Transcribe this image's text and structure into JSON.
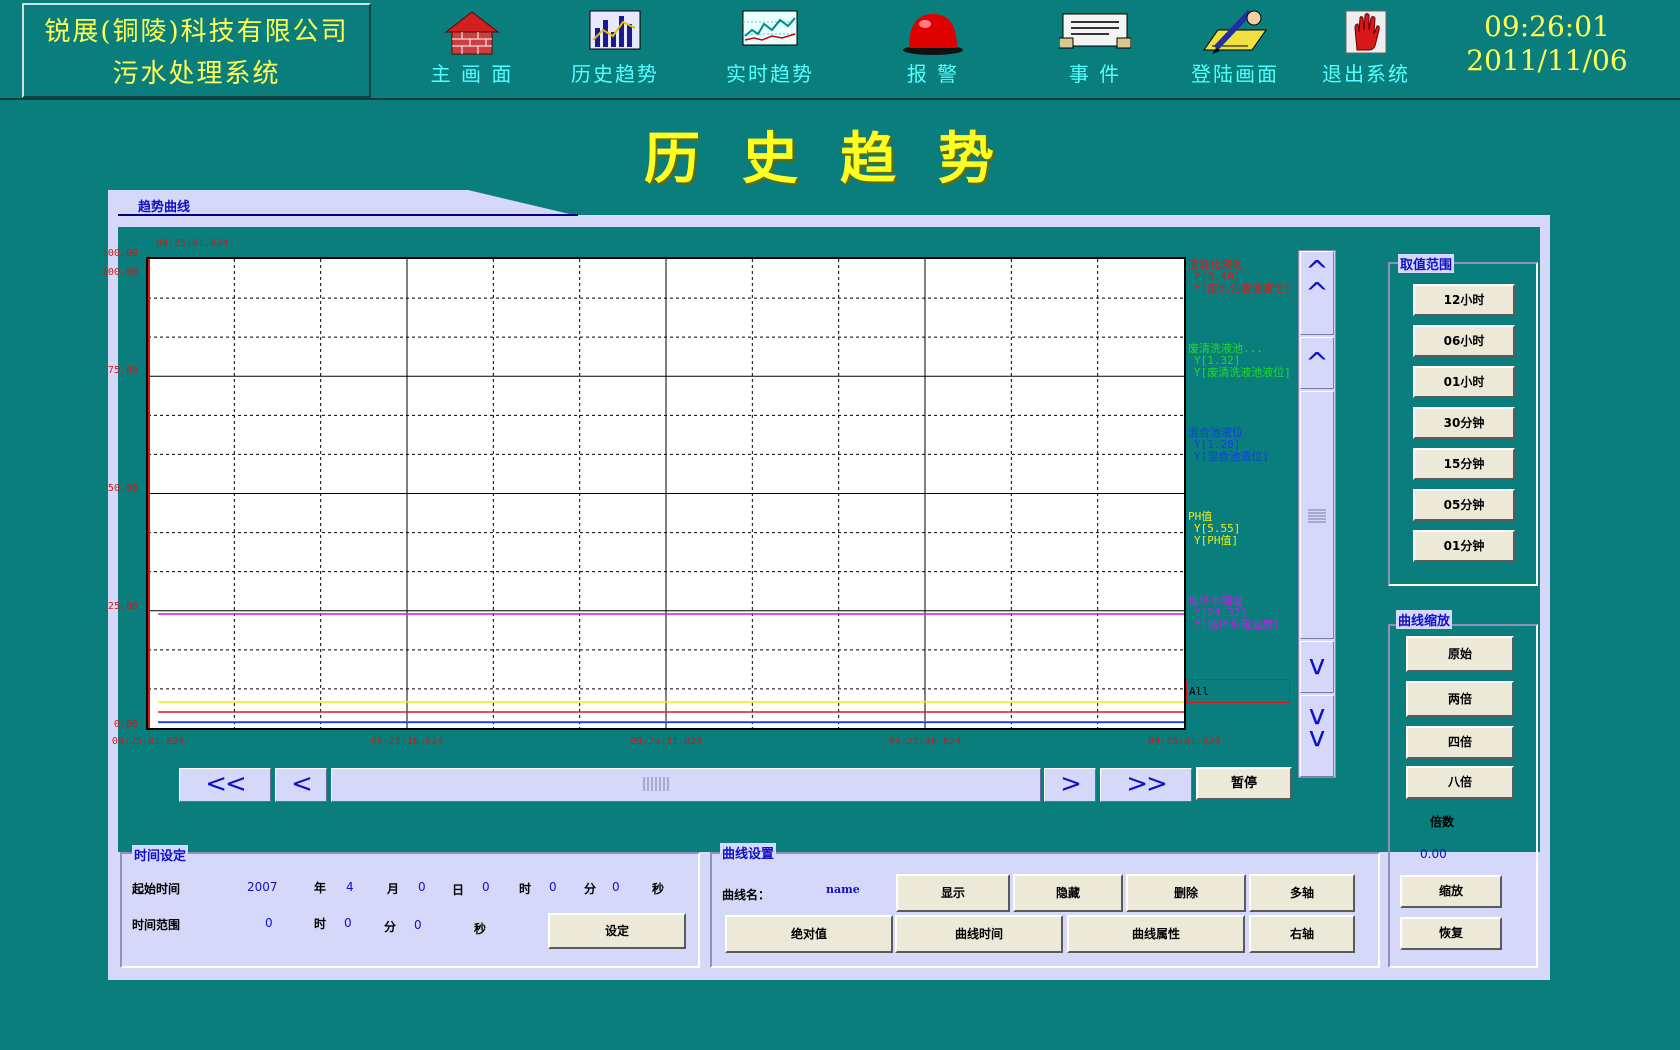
{
  "company": {
    "line1": "锐展(铜陵)科技有限公司",
    "line2": "污水处理系统"
  },
  "nav": [
    {
      "label": "主 画 面",
      "icon": "house-icon"
    },
    {
      "label": "历史趋势",
      "icon": "bar-chart-icon"
    },
    {
      "label": "实时趋势",
      "icon": "line-chart-icon"
    },
    {
      "label": "报    警",
      "icon": "alarm-light-icon"
    },
    {
      "label": "事   件",
      "icon": "printer-icon"
    },
    {
      "label": "登陆画面",
      "icon": "login-pen-icon"
    },
    {
      "label": "退出系统",
      "icon": "stop-hand-icon"
    }
  ],
  "clock": {
    "time": "09:26:01",
    "date": "2011/11/06"
  },
  "page_title": "历史趋势",
  "trend": {
    "tab_label": "趋势曲线",
    "cursor_time": "09:25:01.824",
    "all_label": "All",
    "pause_button": "暂停"
  },
  "chart_data": {
    "type": "line",
    "ylim": [
      0,
      100
    ],
    "y_ticks": [
      "0.00",
      "25.00",
      "50.00",
      "75.00",
      "100.00"
    ],
    "x_ticks": [
      "09:25:01.824",
      "09:25:16.824",
      "09:25:31.824",
      "09:25:46.824",
      "09:26:01.824"
    ],
    "grid": true,
    "series": [
      {
        "name": "废乳化液池",
        "value_label": "Y[3.40]",
        "tag_label": "Y[废乳化液池液位]",
        "color": "#e01818",
        "value": 3.4
      },
      {
        "name": "废清洗液池...",
        "value_label": "Y[1.32]",
        "tag_label": "Y[废清洗液池液位]",
        "color": "#22dd22",
        "value": 1.32
      },
      {
        "name": "混合池液位",
        "value_label": "Y[1.20]",
        "tag_label": "Y[混合池液位]",
        "color": "#1040e8",
        "value": 1.2
      },
      {
        "name": "PH值",
        "value_label": "Y[5.55]",
        "tag_label": "Y[PH值]",
        "color": "#eeee10",
        "value": 5.55
      },
      {
        "name": "循环水箱温",
        "value_label": "Y[24.32]",
        "tag_label": "Y[循环水箱温度]",
        "color": "#c020e0",
        "value": 24.32
      }
    ]
  },
  "range": {
    "title": "取值范围",
    "buttons": [
      "12小时",
      "06小时",
      "01小时",
      "30分钟",
      "15分钟",
      "05分钟",
      "01分钟"
    ]
  },
  "zoom": {
    "title": "曲线缩放",
    "buttons": [
      "原始",
      "两倍",
      "四倍",
      "八倍"
    ],
    "factor_label": "倍数",
    "factor_value": "0.00",
    "zoom_button": "缩放",
    "restore_button": "恢复"
  },
  "time_settings": {
    "title": "时间设定",
    "start_label": "起始时间",
    "year": "2007",
    "year_unit": "年",
    "month": "4",
    "month_unit": "月",
    "day": "0",
    "day_unit": "日",
    "hour": "0",
    "hour_unit": "时",
    "minute": "0",
    "minute_unit": "分",
    "second_unit": "秒",
    "range_label": "时间范围",
    "r_hour": "0",
    "r_hour_unit": "时",
    "r_minute": "0",
    "r_minute_unit": "分",
    "r_second": "0",
    "r_second_unit": "秒",
    "set_button": "设定"
  },
  "curve_settings": {
    "title": "曲线设置",
    "name_label": "曲线名：",
    "name_value": "name",
    "buttons_row1": [
      "显示",
      "隐藏",
      "删除",
      "多轴"
    ],
    "buttons_row2": [
      "绝对值",
      "曲线时间",
      "曲线属性",
      "右轴"
    ]
  }
}
